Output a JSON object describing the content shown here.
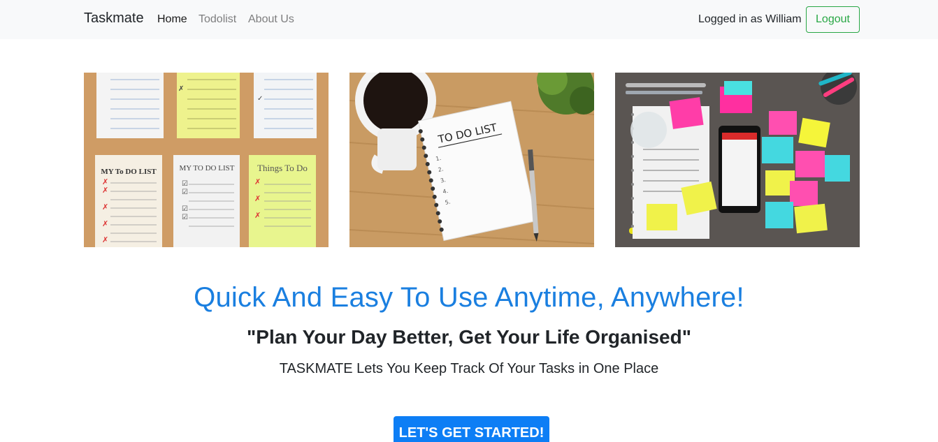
{
  "navbar": {
    "brand": "Taskmate",
    "links": [
      {
        "label": "Home",
        "active": true
      },
      {
        "label": "Todolist",
        "active": false
      },
      {
        "label": "About Us",
        "active": false
      }
    ],
    "logged_in_text": "Logged in as William",
    "logout_label": "Logout"
  },
  "images": [
    {
      "name": "sticky-note-lists-image",
      "notes": [
        "MY To DO LIST",
        "MY TO DO LIST",
        "Things To Do"
      ]
    },
    {
      "name": "notebook-coffee-image",
      "notebook_title": "TO DO LIST"
    },
    {
      "name": "desk-sticky-notes-image"
    }
  ],
  "hero": {
    "headline": "Quick And Easy To Use Anytime, Anywhere!",
    "quote": "\"Plan Your Day Better, Get Your Life Organised\"",
    "subline": "TASKMATE Lets You Keep Track Of Your Tasks in One Place",
    "cta_label": "LET'S GET STARTED!"
  },
  "colors": {
    "navbar_bg": "#f8f9fa",
    "headline": "#1a7fe0",
    "cta_bg": "#0d7ef5",
    "logout": "#28a745"
  }
}
